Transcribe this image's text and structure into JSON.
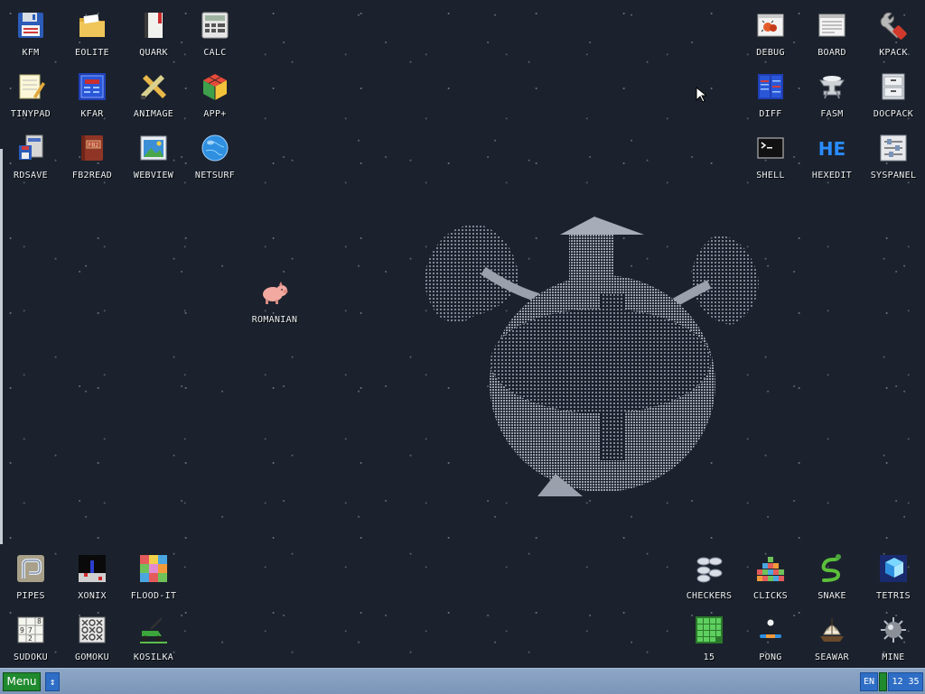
{
  "desktop": {
    "icons_left_top": [
      {
        "label": "KFM",
        "icon": "floppy-disk-icon"
      },
      {
        "label": "EOLITE",
        "icon": "folder-icon"
      },
      {
        "label": "QUARK",
        "icon": "notebook-icon"
      },
      {
        "label": "CALC",
        "icon": "calculator-icon"
      },
      {
        "label": "TINYPAD",
        "icon": "notepad-icon"
      },
      {
        "label": "KFAR",
        "icon": "archive-icon"
      },
      {
        "label": "ANIMAGE",
        "icon": "paint-tools-icon"
      },
      {
        "label": "APP+",
        "icon": "rubik-cube-icon"
      },
      {
        "label": "RDSAVE",
        "icon": "ram-save-icon"
      },
      {
        "label": "FB2READ",
        "icon": "book-icon"
      },
      {
        "label": "WEBVIEW",
        "icon": "webview-icon"
      },
      {
        "label": "NETSURF",
        "icon": "globe-icon"
      }
    ],
    "icon_middle": {
      "label": "ROMANIAN",
      "icon": "pig-icon"
    },
    "icons_right_top": [
      {
        "label": "DEBUG",
        "icon": "bug-icon"
      },
      {
        "label": "BOARD",
        "icon": "board-icon"
      },
      {
        "label": "KPACK",
        "icon": "wrench-icon"
      },
      {
        "label": "DIFF",
        "icon": "diff-icon"
      },
      {
        "label": "FASM",
        "icon": "anvil-icon"
      },
      {
        "label": "DOCPACK",
        "icon": "cabinet-icon"
      },
      {
        "label": "SHELL",
        "icon": "terminal-icon"
      },
      {
        "label": "HEXEDIT",
        "icon": "hex-icon"
      },
      {
        "label": "SYSPANEL",
        "icon": "sliders-icon"
      }
    ],
    "icons_left_bottom": [
      {
        "label": "PIPES",
        "icon": "pipes-icon"
      },
      {
        "label": "XONIX",
        "icon": "xonix-icon"
      },
      {
        "label": "FLOOD-IT",
        "icon": "flood-it-icon"
      },
      {
        "label": "SUDOKU",
        "icon": "sudoku-icon"
      },
      {
        "label": "GOMOKU",
        "icon": "gomoku-icon"
      },
      {
        "label": "KOSILKA",
        "icon": "lawnmower-icon"
      }
    ],
    "icons_right_bottom": [
      {
        "label": "CHECKERS",
        "icon": "checkers-icon"
      },
      {
        "label": "CLICKS",
        "icon": "clicks-icon"
      },
      {
        "label": "SNAKE",
        "icon": "snake-icon"
      },
      {
        "label": "TETRIS",
        "icon": "tetris-icon"
      },
      {
        "label": "15",
        "icon": "fifteen-icon"
      },
      {
        "label": "PONG",
        "icon": "pong-icon"
      },
      {
        "label": "SEAWAR",
        "icon": "ship-icon"
      },
      {
        "label": "MINE",
        "icon": "mine-icon"
      }
    ],
    "sudoku_digits": [
      "9",
      "7",
      "8",
      "2"
    ]
  },
  "taskbar": {
    "menu_label": "Menu",
    "switch_glyph": "↕",
    "language": "EN",
    "clock": "12 35"
  }
}
